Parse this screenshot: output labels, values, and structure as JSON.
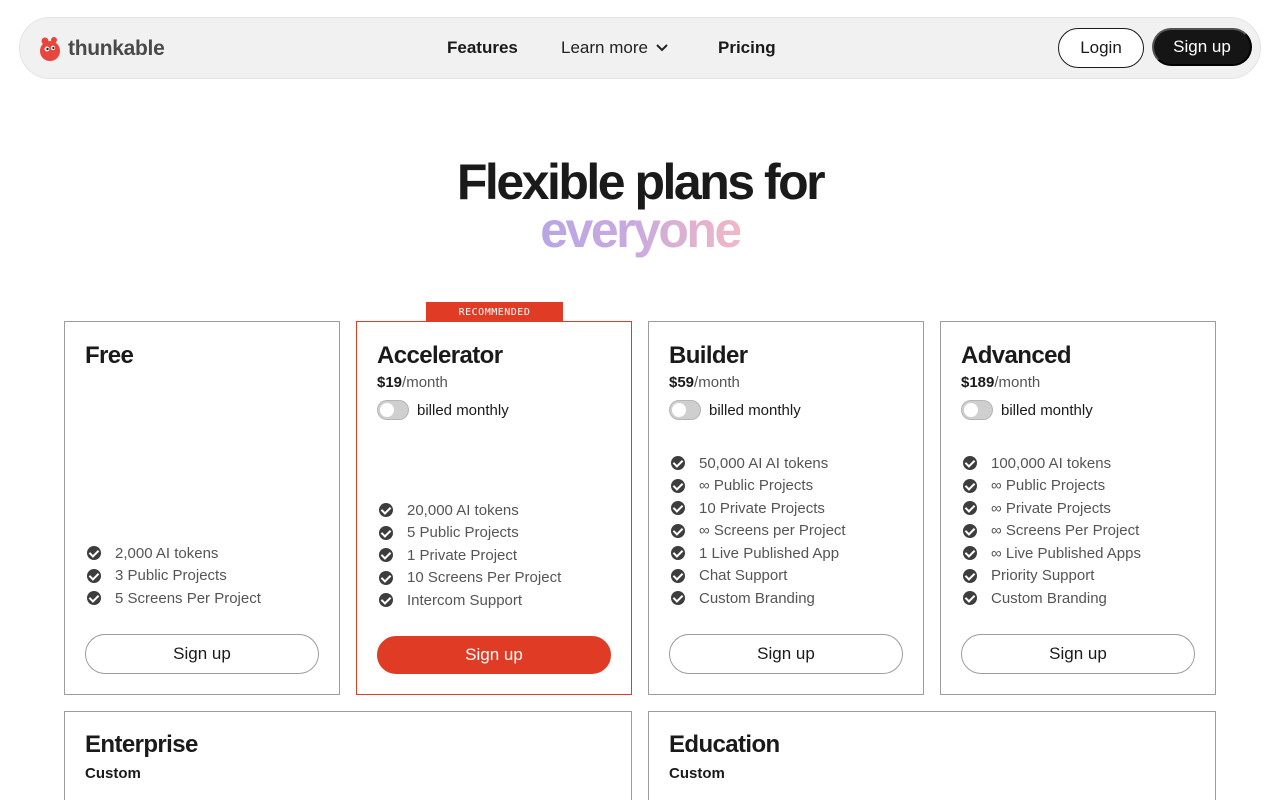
{
  "nav": {
    "brand": "thunkable",
    "links": [
      "Features",
      "Learn more",
      "Pricing"
    ],
    "login": "Login",
    "signup": "Sign up"
  },
  "hero": {
    "line1": "Flexible plans for",
    "line2": "everyone"
  },
  "badge": "RECOMMENDED",
  "plans": [
    {
      "name": "Free",
      "features": [
        "2,000 AI tokens",
        "3 Public Projects",
        "5 Screens Per Project"
      ],
      "cta": "Sign up"
    },
    {
      "name": "Accelerator",
      "price": "$19",
      "period": "/month",
      "billing": "billed monthly",
      "features": [
        "20,000 AI tokens",
        "5 Public Projects",
        "1 Private Project",
        "10 Screens Per Project",
        "Intercom Support"
      ],
      "cta": "Sign up"
    },
    {
      "name": "Builder",
      "price": "$59",
      "period": "/month",
      "billing": "billed monthly",
      "features": [
        "50,000 AI AI tokens",
        "∞ Public Projects",
        "10 Private Projects",
        "∞ Screens per Project",
        "1 Live Published App",
        "Chat Support",
        "Custom Branding"
      ],
      "cta": "Sign up"
    },
    {
      "name": "Advanced",
      "price": "$189",
      "period": "/month",
      "billing": "billed monthly",
      "features": [
        "100,000 AI tokens",
        "∞ Public Projects",
        "∞ Private Projects",
        "∞  Screens Per Project",
        "∞  Live Published Apps",
        "Priority Support",
        "Custom Branding"
      ],
      "cta": "Sign up"
    }
  ],
  "extra_plans": [
    {
      "name": "Enterprise",
      "price": "Custom"
    },
    {
      "name": "Education",
      "price": "Custom"
    }
  ],
  "colors": {
    "accent": "#e03b24",
    "dark": "#151515"
  }
}
